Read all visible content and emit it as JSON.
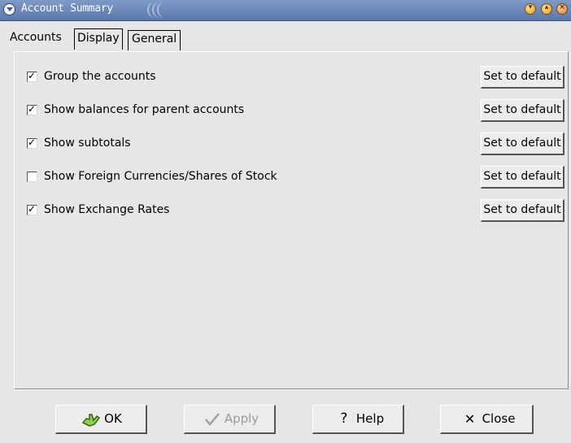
{
  "window": {
    "title": "Account Summary",
    "title_controls": [
      "minimize-icon",
      "maximize-icon",
      "close-icon"
    ]
  },
  "tabs": [
    {
      "label": "Accounts",
      "active": false
    },
    {
      "label": "Display",
      "active": true
    },
    {
      "label": "General",
      "active": false
    }
  ],
  "options": [
    {
      "label": "Group the accounts",
      "checked": true,
      "button": "Set to default"
    },
    {
      "label": "Show balances for parent accounts",
      "checked": true,
      "button": "Set to default"
    },
    {
      "label": "Show subtotals",
      "checked": true,
      "button": "Set to default"
    },
    {
      "label": "Show Foreign Currencies/Shares of Stock",
      "checked": false,
      "button": "Set to default"
    },
    {
      "label": "Show Exchange Rates",
      "checked": true,
      "button": "Set to default"
    }
  ],
  "buttons": {
    "ok": {
      "label": "OK",
      "icon": "ok-hand-icon",
      "enabled": true
    },
    "apply": {
      "label": "Apply",
      "icon": "checkmark-icon",
      "enabled": false
    },
    "help": {
      "label": "Help",
      "icon": "question-icon",
      "enabled": true
    },
    "close": {
      "label": "Close",
      "icon": "x-icon",
      "enabled": true
    }
  },
  "colors": {
    "titlebar": "#6a86b8",
    "background": "#e6e6e6"
  }
}
